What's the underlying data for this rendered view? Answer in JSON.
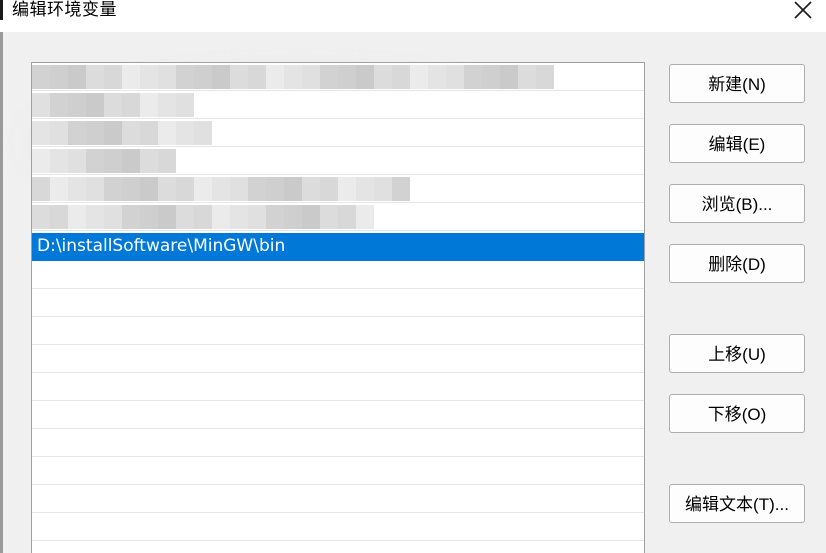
{
  "window": {
    "title": "编辑环境变量",
    "close_symbol": "✕"
  },
  "list": {
    "selected_entry": "D:\\installSoftware\\MinGW\\bin",
    "pixelated_rows": 6,
    "blank_rows": 11
  },
  "buttons": {
    "new": "新建(N)",
    "edit": "编辑(E)",
    "browse": "浏览(B)...",
    "delete": "删除(D)",
    "move_up": "上移(U)",
    "move_down": "下移(O)",
    "edit_text": "编辑文本(T)..."
  },
  "colors": {
    "selection": "#0078d7",
    "dialog_bg": "#f0f0f0",
    "list_bg": "#ffffff"
  }
}
